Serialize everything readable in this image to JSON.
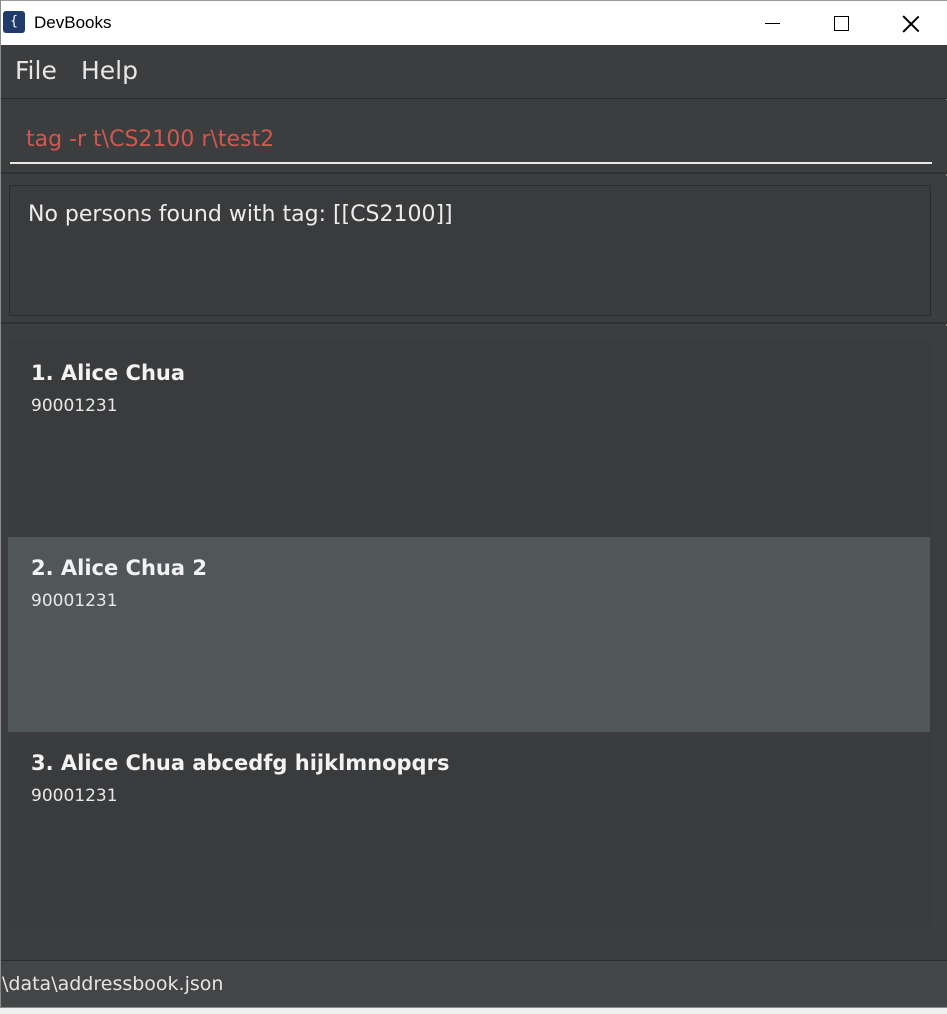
{
  "window": {
    "title": "DevBooks",
    "icon_glyph": "{⎕}"
  },
  "menu": {
    "file": "File",
    "help": "Help"
  },
  "command": {
    "value": "tag -r t\\CS2100 r\\test2"
  },
  "result": {
    "message": "No persons found with tag: [[CS2100]]"
  },
  "persons": [
    {
      "index": "1.",
      "name": "1. Alice Chua",
      "phone": "90001231"
    },
    {
      "index": "2.",
      "name": "2. Alice Chua 2",
      "phone": "90001231"
    },
    {
      "index": "3.",
      "name": "3. Alice Chua abcedfg hijklmnopqrs",
      "phone": "90001231"
    }
  ],
  "status": {
    "path": "\\data\\addressbook.json"
  },
  "colors": {
    "background": "#3c3d3f",
    "selected_card": "#515658",
    "command_text": "#d0584d"
  }
}
